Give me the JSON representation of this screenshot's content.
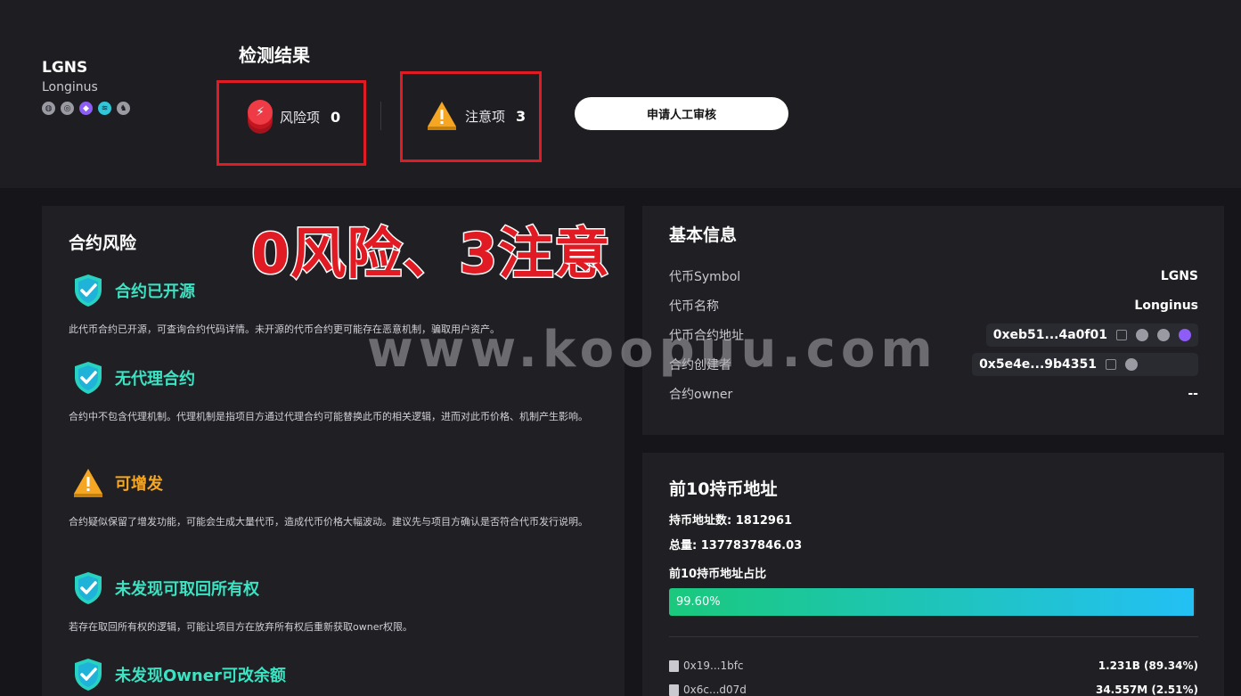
{
  "token": {
    "symbol": "LGNS",
    "name": "Longinus"
  },
  "header": {
    "title": "检测结果",
    "risk_label": "风险项",
    "risk_count": "0",
    "notice_label": "注意项",
    "notice_count": "3",
    "review_button": "申请人工审核"
  },
  "overlay": {
    "headline": "0风险、3注意",
    "watermark": "www.koopuu.com"
  },
  "contract": {
    "title": "合约风险",
    "items": [
      {
        "title": "合约已开源",
        "status": "ok",
        "desc": "此代币合约已开源，可查询合约代码详情。未开源的代币合约更可能存在恶意机制，骗取用户资产。"
      },
      {
        "title": "无代理合约",
        "status": "ok",
        "desc": "合约中不包含代理机制。代理机制是指项目方通过代理合约可能替换此币的相关逻辑，进而对此币价格、机制产生影响。"
      },
      {
        "title": "可增发",
        "status": "warn",
        "desc": "合约疑似保留了增发功能，可能会生成大量代币，造成代币价格大幅波动。建议先与项目方确认是否符合代币发行说明。"
      },
      {
        "title": "未发现可取回所有权",
        "status": "ok",
        "desc": "若存在取回所有权的逻辑，可能让项目方在放弃所有权后重新获取owner权限。"
      },
      {
        "title": "未发现Owner可改余额",
        "status": "ok",
        "desc": ""
      }
    ]
  },
  "basic": {
    "title": "基本信息",
    "symbol_label": "代币Symbol",
    "symbol_value": "LGNS",
    "name_label": "代币名称",
    "name_value": "Longinus",
    "address_label": "代币合约地址",
    "address_value": "0xeb51...4a0f01",
    "creator_label": "合约创建者",
    "creator_value": "0x5e4e...9b4351",
    "owner_label": "合约owner",
    "owner_value": "--"
  },
  "holders": {
    "title": "前10持币地址",
    "count_text": "持币地址数: 1812961",
    "total_text": "总量: 1377837846.03",
    "ratio_label": "前10持币地址占比",
    "ratio_text": "99.60%",
    "ratio_value": 0.996,
    "rows": [
      {
        "addr": "0x19...1bfc",
        "amount": "1.231B  (89.34%)"
      },
      {
        "addr": "0x6c...d07d",
        "amount": "34.557M  (2.51%)"
      }
    ]
  },
  "colors": {
    "ok": "#3be3c2",
    "warn": "#f5a623",
    "danger": "#e01b24",
    "progress_start": "#1ac97d",
    "progress_end": "#23c0f5"
  }
}
